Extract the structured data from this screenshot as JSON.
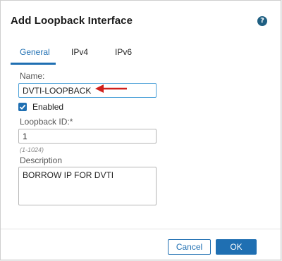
{
  "dialog": {
    "title": "Add Loopback Interface",
    "help_icon": "?"
  },
  "tabs": [
    {
      "label": "General",
      "active": true
    },
    {
      "label": "IPv4",
      "active": false
    },
    {
      "label": "IPv6",
      "active": false
    }
  ],
  "form": {
    "name_label": "Name:",
    "name_value": "DVTI-LOOPBACK",
    "enabled_label": "Enabled",
    "enabled_checked": true,
    "loopback_id_label": "Loopback ID:*",
    "loopback_id_value": "1",
    "loopback_id_hint": "(1-1024)",
    "description_label": "Description",
    "description_value": "BORROW IP FOR DVTI"
  },
  "footer": {
    "cancel_label": "Cancel",
    "ok_label": "OK"
  },
  "colors": {
    "accent": "#1f6fb2",
    "annotation_arrow": "#d0211c"
  },
  "icons": [
    "help-icon",
    "checkmark-icon",
    "annotation-arrow-icon"
  ]
}
